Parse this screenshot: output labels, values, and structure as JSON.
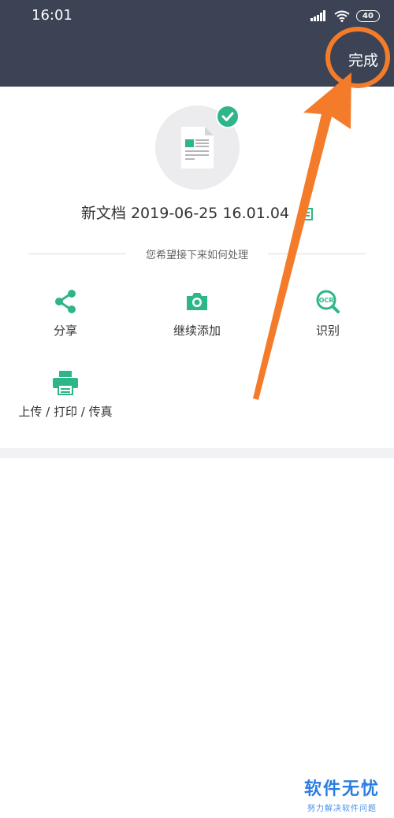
{
  "status_bar": {
    "time": "16:01",
    "battery": "40"
  },
  "app_bar": {
    "done_label": "完成"
  },
  "document": {
    "title": "新文档 2019-06-25 16.01.04"
  },
  "prompt": {
    "label": "您希望接下来如何处理"
  },
  "actions": [
    {
      "label": "分享",
      "icon": "share-icon"
    },
    {
      "label": "继续添加",
      "icon": "camera-icon"
    },
    {
      "label": "识别",
      "icon": "ocr-search-icon"
    },
    {
      "label": "上传 / 打印 / 传真",
      "icon": "printer-icon"
    }
  ],
  "watermark": {
    "main": "软件无忧",
    "sub": "努力解决软件问题"
  },
  "colors": {
    "accent": "#2fb58a",
    "header": "#3b4354",
    "annotation": "#f47b2a"
  }
}
